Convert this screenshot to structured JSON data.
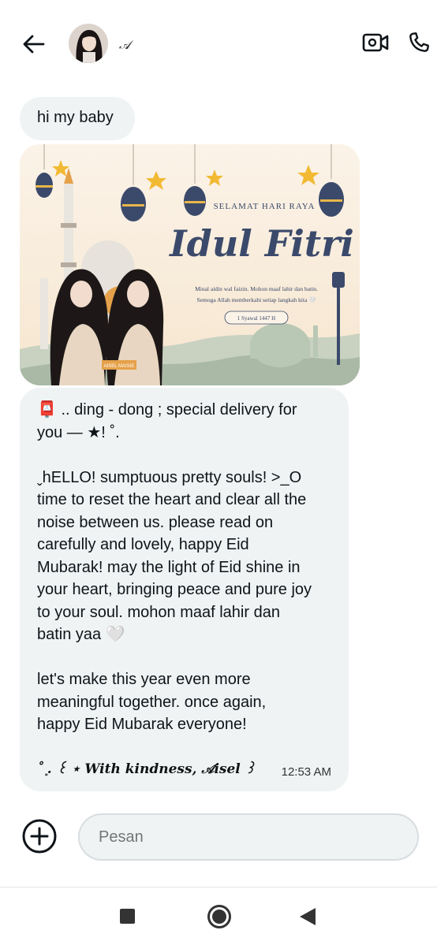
{
  "header": {
    "contact_name": "𝒜",
    "back_icon": "arrow-left-icon",
    "video_icon": "video-camera-icon",
    "call_icon": "phone-icon"
  },
  "messages": {
    "greeting": "hi my baby",
    "card": {
      "kicker": "SELAMAT HARI RAYA",
      "title": "Idul Fitri",
      "line1": "Minal aidin wal faizin. Mohon maaf lahir dan batin.",
      "line2": "Semoga Allah memberkahi setiap langkah kita 🤍",
      "date": "1 Syawal 1447 H",
      "name_tag": "AISEL MAISIE"
    },
    "long_message": {
      "lines": [
        "📮 .. ding - dong ; special delivery for",
        "you — ★! ˚.",
        "",
        "ˬhELLO! sumptuous pretty souls! >_O",
        "time to reset the heart and clear all the",
        "noise between us. please read on",
        "carefully and lovely, happy Eid",
        "Mubarak! may the light of Eid shine in",
        "your heart, bringing peace and pure joy",
        "to your soul. mohon maaf lahir dan",
        "batin yaa 🤍",
        "",
        "let's make this year even more",
        "meaningful together. once again,",
        "happy Eid Mubarak everyone!"
      ],
      "signature": "˚ ͙. ꒰ ⋆ With kindness, 𝒜isel ꒱",
      "time": "12:53 AM"
    }
  },
  "composer": {
    "add_icon": "plus-circle-icon",
    "placeholder": "Pesan"
  },
  "navbar": {
    "recents_icon": "square-icon",
    "home_icon": "circle-icon",
    "back_icon": "triangle-back-icon"
  },
  "colors": {
    "bubble": "#eff3f4",
    "card_navy": "#3b4a6b",
    "card_gold": "#f2b933"
  }
}
